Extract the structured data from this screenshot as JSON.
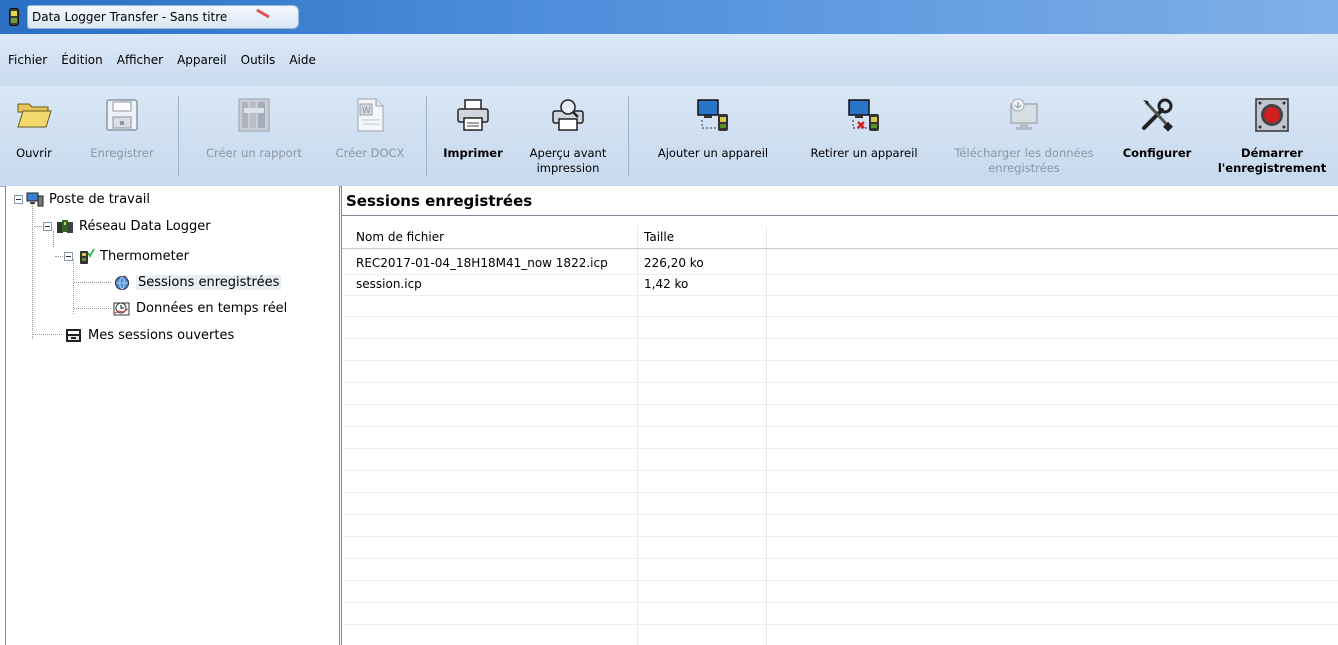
{
  "window": {
    "title": "Data Logger Transfer - Sans titre"
  },
  "menu": [
    "Fichier",
    "Édition",
    "Afficher",
    "Appareil",
    "Outils",
    "Aide"
  ],
  "toolbar": {
    "buttons": [
      {
        "label": "Ouvrir",
        "icon": "folder-open-icon",
        "enabled": true
      },
      {
        "label": "Enregistrer",
        "icon": "floppy-disk-icon",
        "enabled": false
      },
      {
        "label": "Créer un rapport",
        "icon": "report-icon",
        "enabled": false
      },
      {
        "label": "Créer DOCX",
        "icon": "word-document-icon",
        "enabled": false
      },
      {
        "label": "Imprimer",
        "icon": "printer-icon",
        "enabled": true
      },
      {
        "label": "Aperçu avant impression",
        "icon": "print-preview-icon",
        "enabled": true
      },
      {
        "label": "Ajouter un appareil",
        "icon": "add-device-icon",
        "enabled": true
      },
      {
        "label": "Retirer un appareil",
        "icon": "remove-device-icon",
        "enabled": true
      },
      {
        "label": "Télécharger les données enregistrées",
        "icon": "download-data-icon",
        "enabled": false
      },
      {
        "label": "Configurer",
        "icon": "tools-icon",
        "enabled": true
      },
      {
        "label": "Démarrer l'enregistrement",
        "icon": "record-icon",
        "enabled": true
      }
    ]
  },
  "tree": {
    "root": "Poste de travail",
    "network": "Réseau Data Logger",
    "device": "Thermometer",
    "sessions": "Sessions enregistrées",
    "realtime": "Données en temps réel",
    "open_sessions": "Mes sessions ouvertes"
  },
  "main": {
    "title": "Sessions enregistrées",
    "columns": [
      "Nom de fichier",
      "Taille"
    ],
    "rows": [
      [
        "REC2017-01-04_18H18M41_now 1822.icp",
        "226,20 ko"
      ],
      [
        "session.icp",
        "1,42 ko"
      ]
    ]
  }
}
